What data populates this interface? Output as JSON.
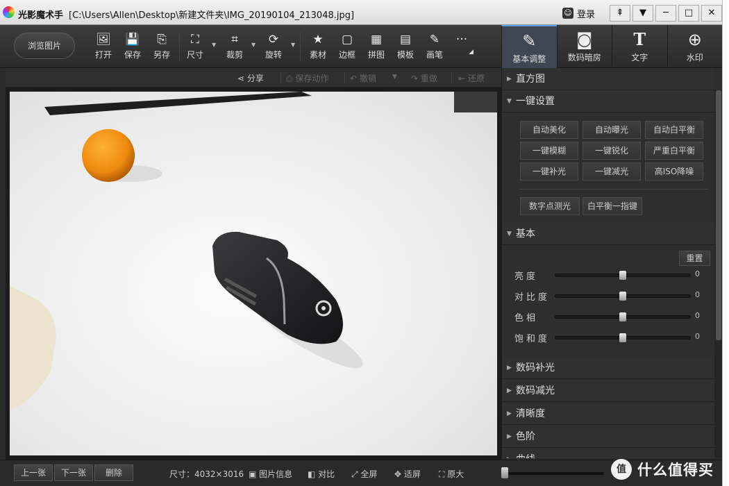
{
  "window": {
    "app_name": "光影魔术手",
    "file_path": "[C:\\Users\\Allen\\Desktop\\新建文件夹\\IMG_20190104_213048.jpg]",
    "login_label": "登录",
    "buttons": {
      "pin": "⇞",
      "menu": "▼",
      "minimize": "─",
      "maximize": "□",
      "close": "✕"
    }
  },
  "toolbar": {
    "browse_label": "浏览图片",
    "tools": [
      {
        "label": "打开",
        "icon": "open-icon",
        "glyph": "🖼"
      },
      {
        "label": "保存",
        "icon": "save-icon",
        "glyph": "💾"
      },
      {
        "label": "另存",
        "icon": "save-as-icon",
        "glyph": "⎘"
      },
      {
        "label": "尺寸",
        "icon": "resize-icon",
        "glyph": "⛶"
      },
      {
        "label": "裁剪",
        "icon": "crop-icon",
        "glyph": "⌗"
      },
      {
        "label": "旋转",
        "icon": "rotate-icon",
        "glyph": "⟳"
      },
      {
        "label": "素材",
        "icon": "material-icon",
        "glyph": "★"
      },
      {
        "label": "边框",
        "icon": "border-icon",
        "glyph": "▢"
      },
      {
        "label": "拼图",
        "icon": "collage-icon",
        "glyph": "▦"
      },
      {
        "label": "模板",
        "icon": "template-icon",
        "glyph": "▤"
      },
      {
        "label": "画笔",
        "icon": "brush-icon",
        "glyph": "✎"
      }
    ],
    "more_glyph": "···",
    "right_tabs": [
      {
        "label": "基本调整",
        "icon": "basic-adjust-icon",
        "glyph": "✎",
        "active": true
      },
      {
        "label": "数码暗房",
        "icon": "darkroom-icon",
        "glyph": "◙",
        "active": false
      },
      {
        "label": "文字",
        "icon": "text-icon",
        "glyph": "T",
        "active": false
      },
      {
        "label": "水印",
        "icon": "watermark-icon",
        "glyph": "⊕",
        "active": false
      }
    ]
  },
  "actions": {
    "share": "分享",
    "save_action": "保存动作",
    "undo": "撤销",
    "redo": "重做",
    "restore": "还原"
  },
  "panel": {
    "histogram": "直方图",
    "one_click": "一键设置",
    "one_click_buttons": [
      "自动美化",
      "自动曝光",
      "自动白平衡",
      "一键模糊",
      "一键锐化",
      "严重白平衡",
      "一键补光",
      "一键减光",
      "高ISO降噪"
    ],
    "extra_buttons": [
      "数字点测光",
      "白平衡一指键"
    ],
    "basic": "基本",
    "reset": "重置",
    "sliders": [
      {
        "label": "亮度",
        "value": "0"
      },
      {
        "label": "对比度",
        "value": "0"
      },
      {
        "label": "色相",
        "value": "0"
      },
      {
        "label": "饱和度",
        "value": "0"
      }
    ],
    "sections": [
      "数码补光",
      "数码减光",
      "清晰度",
      "色阶",
      "曲线"
    ]
  },
  "status": {
    "prev": "上一张",
    "next": "下一张",
    "delete": "删除",
    "size": "尺寸：4032×3016",
    "info": "图片信息",
    "compare": "对比",
    "fullscreen": "全屏",
    "fit": "适屏",
    "original": "原大",
    "zoom_percent": 0
  },
  "watermark": {
    "logo": "值",
    "text": "什么值得买"
  }
}
